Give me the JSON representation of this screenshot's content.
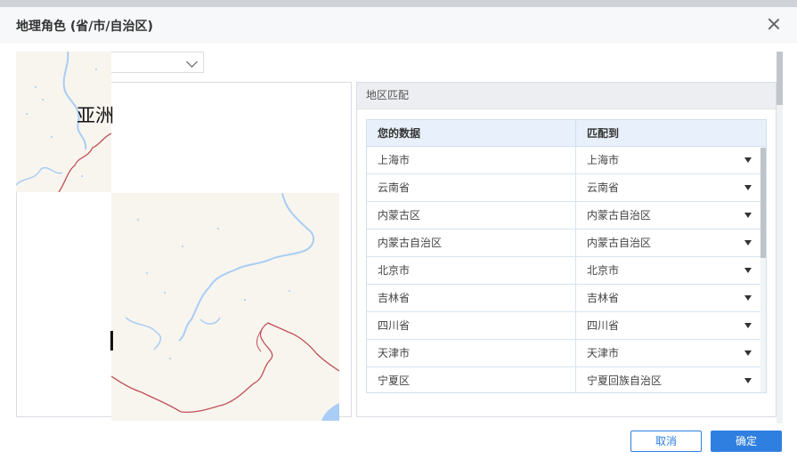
{
  "dialog": {
    "title": "地理角色 (省/市/自治区)",
    "close_icon": "close-icon"
  },
  "map": {
    "label": "亚洲"
  },
  "panel": {
    "title": "地区匹配",
    "columns": [
      "您的数据",
      "匹配到"
    ],
    "rows": [
      {
        "data": "上海市",
        "match": "上海市"
      },
      {
        "data": "云南省",
        "match": "云南省"
      },
      {
        "data": "内蒙古区",
        "match": "内蒙古自治区"
      },
      {
        "data": "内蒙古自治区",
        "match": "内蒙古自治区"
      },
      {
        "data": "北京市",
        "match": "北京市"
      },
      {
        "data": "吉林省",
        "match": "吉林省"
      },
      {
        "data": "四川省",
        "match": "四川省"
      },
      {
        "data": "天津市",
        "match": "天津市"
      },
      {
        "data": "宁夏区",
        "match": "宁夏回族自治区"
      }
    ]
  },
  "footer": {
    "cancel_label": "取消",
    "ok_label": "确定"
  },
  "colors": {
    "primary": "#2f7fe0",
    "header_bg": "#e8f1fb",
    "map_land": "#f8f5ee",
    "map_water": "#a9cdf5",
    "map_border": "#c0505a"
  }
}
